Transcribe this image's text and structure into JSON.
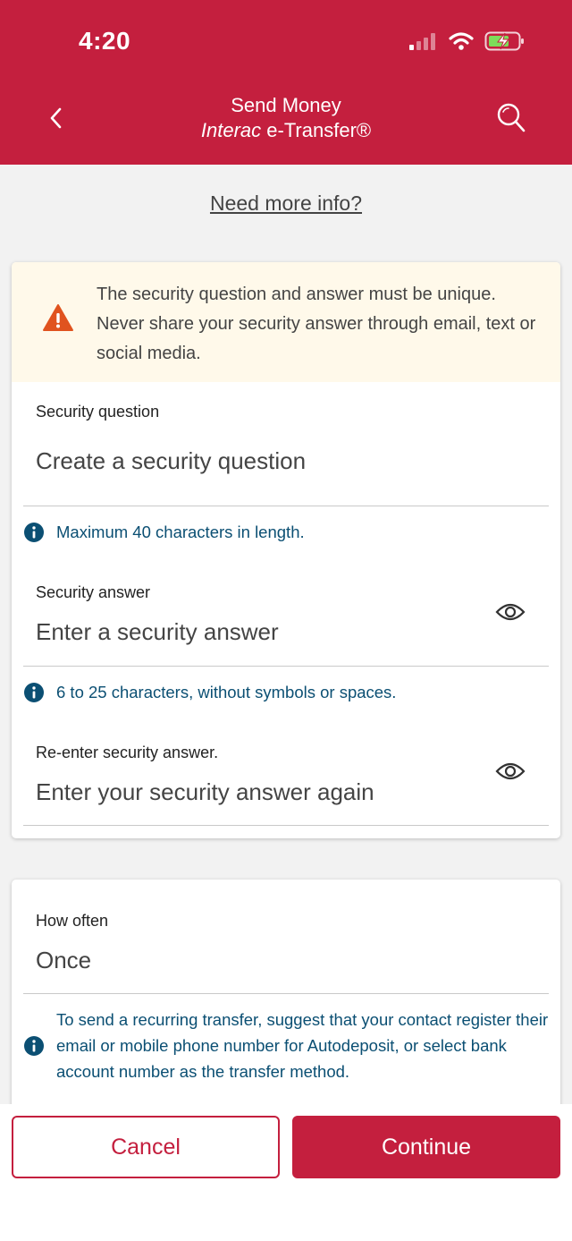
{
  "status_bar": {
    "time": "4:20",
    "icons": [
      "signal-icon",
      "wifi-icon",
      "battery-charging-icon"
    ]
  },
  "header": {
    "title": "Send Money",
    "subtitle_brand": "Interac",
    "subtitle_rest": " e-Transfer®",
    "back_icon": "chevron-left-icon",
    "search_icon": "search-icon"
  },
  "need_info_link": "Need more info?",
  "security_card": {
    "warning": {
      "icon": "warning-triangle-icon",
      "text": "The security question and answer must be unique. Never share your security answer through email, text or social media."
    },
    "question": {
      "label": "Security question",
      "placeholder": "Create a security question",
      "hint": "Maximum 40 characters in length."
    },
    "answer": {
      "label": "Security answer",
      "placeholder": "Enter a security answer",
      "hint": "6 to 25 characters, without symbols or spaces."
    },
    "reenter": {
      "label": "Re-enter security answer.",
      "placeholder": "Enter your security answer again"
    }
  },
  "frequency_card": {
    "label": "How often",
    "value": "Once",
    "hint": "To send a recurring transfer, suggest that your contact register their email or mobile phone number for Autodeposit, or select bank account number as the transfer method."
  },
  "buttons": {
    "cancel": "Cancel",
    "continue": "Continue"
  },
  "colors": {
    "brand_red": "#c41f3e",
    "info_blue": "#0b4f73",
    "warning_orange": "#e0531f",
    "warning_bg": "#fff9ea"
  }
}
